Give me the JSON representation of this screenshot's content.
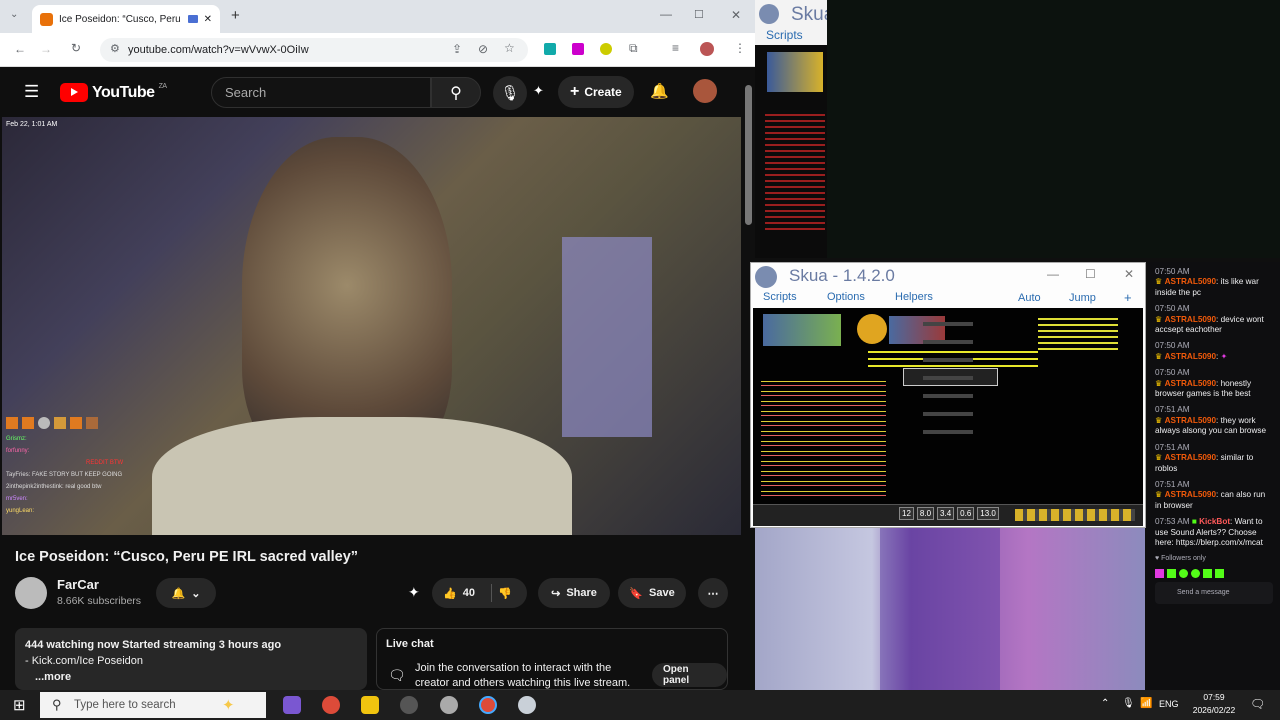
{
  "browser": {
    "tab_title": "Ice Poseidon: “Cusco, Peru",
    "url": "youtube.com/watch?v=wVvwX-0OiIw"
  },
  "youtube": {
    "logo_text": "YouTube",
    "country": "ZA",
    "search_placeholder": "Search",
    "create_label": "Create",
    "video_timestamp": "Feb 22, 1:01 AM",
    "video_title": "Ice Poseidon: “Cusco, Peru PE IRL sacred valley”",
    "channel_name": "FarCar",
    "subscribers": "8.66K subscribers",
    "likes": "40",
    "share_label": "Share",
    "save_label": "Save",
    "description": {
      "line1": "444 watching now  Started streaming 3 hours ago",
      "line2": "- Kick.com/Ice Poseidon",
      "more": "...more"
    },
    "live_chat": {
      "title": "Live chat",
      "text": "Join the conversation to interact with the creator and others watching this live stream.",
      "open_panel": "Open panel"
    },
    "overlay_chat": [
      "Grismz:",
      "forfunny:",
      "REDDIT BTW",
      "TayFries: FAKE STORY BUT KEEP GOING",
      "2inthepink2inthestink: real good btw",
      "mr5ven:",
      "yungLean:"
    ]
  },
  "skua": {
    "title": "Skua - 1.4.2.0",
    "top_title": "Skua",
    "menu": [
      "Scripts",
      "Options",
      "Helpers"
    ],
    "right_menu": [
      "Auto",
      "Jump",
      "+"
    ],
    "bar_values": [
      "12",
      "8.0",
      "3.4",
      "0.6",
      "13.0"
    ]
  },
  "twitch_chat": {
    "messages": [
      {
        "time": "07:50 AM",
        "user": "ASTRAL5090",
        "text": ": its like war inside the pc"
      },
      {
        "time": "07:50 AM",
        "user": "ASTRAL5090",
        "text": ": device wont accsept eachother"
      },
      {
        "time": "07:50 AM",
        "user": "ASTRAL5090",
        "text": ":"
      },
      {
        "time": "07:50 AM",
        "user": "ASTRAL5090",
        "text": ": honestly browser games is the best"
      },
      {
        "time": "07:51 AM",
        "user": "ASTRAL5090",
        "text": ": they work always alsong you can browse"
      },
      {
        "time": "07:51 AM",
        "user": "ASTRAL5090",
        "text": ": similar to roblos"
      },
      {
        "time": "07:51 AM",
        "user": "ASTRAL5090",
        "text": ": can also run in browser"
      },
      {
        "time": "07:53 AM",
        "user": "KickBot",
        "text": ": Want to use Sound Alerts?? Choose here: https://blerp.com/x/mcat"
      }
    ],
    "followers_only": "Followers only",
    "send_placeholder": "Send a message"
  },
  "taskbar": {
    "search_placeholder": "Type here to search",
    "language": "ENG",
    "time": "07:59",
    "date": "2026/02/22"
  }
}
